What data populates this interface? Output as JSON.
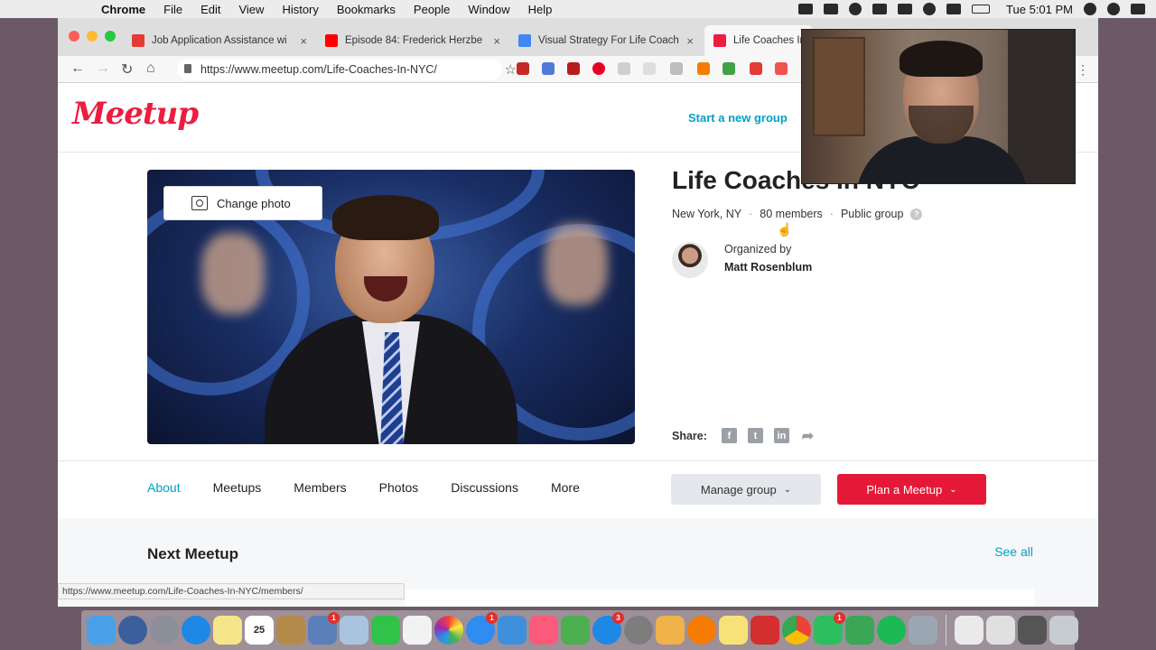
{
  "menubar": {
    "app": "Chrome",
    "items": [
      "File",
      "Edit",
      "View",
      "History",
      "Bookmarks",
      "People",
      "Window",
      "Help"
    ],
    "clock": "Tue 5:01 PM"
  },
  "tabs": [
    {
      "title": "Job Application Assistance wi",
      "color": "#e53935"
    },
    {
      "title": "Episode 84: Frederick Herzbe",
      "color": "#ff0000"
    },
    {
      "title": "Visual Strategy For Life Coach",
      "color": "#4285f4"
    },
    {
      "title": "Life Coaches In",
      "color": "#ed1c40"
    }
  ],
  "address": {
    "url": "https://www.meetup.com/Life-Coaches-In-NYC/"
  },
  "page": {
    "logo": "Meetup",
    "start_group": "Start a new group",
    "change_photo": "Change photo",
    "group_title": "Life Coaches In NYC",
    "location": "New York, NY",
    "members": "80 members",
    "privacy": "Public group",
    "help_mark": "?",
    "organized_by": "Organized by",
    "organizer": "Matt Rosenblum",
    "share_label": "Share:",
    "nav_tabs": [
      "About",
      "Meetups",
      "Members",
      "Photos",
      "Discussions",
      "More"
    ],
    "manage_group": "Manage group",
    "plan_meetup": "Plan a Meetup",
    "next_meetup": "Next Meetup",
    "see_all": "See all",
    "status_url": "https://www.meetup.com/Life-Coaches-In-NYC/members/"
  },
  "colors": {
    "brand": "#ed1c40",
    "link": "#00a2c7",
    "primary_button": "#e51937"
  },
  "dock": {
    "badges": [
      "1",
      "1",
      "3",
      "1"
    ],
    "calendar_day": "25"
  }
}
